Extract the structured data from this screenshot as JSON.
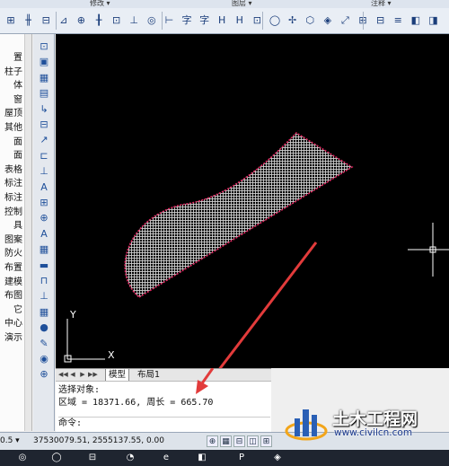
{
  "ribbon": {
    "groups": [
      "修改 ▾",
      "图层 ▾",
      "注释 ▾"
    ],
    "tools": [
      "⊞",
      "╫",
      "⊟",
      "⊿",
      "⊕",
      "╂",
      "⊡",
      "⊥",
      "◎",
      "⊢",
      "字",
      "字",
      "H",
      "H",
      "⊡",
      "◯",
      "✢",
      "⬡",
      "◈",
      "⤢",
      "⊞",
      "⊟",
      "≡",
      "◧",
      "◨"
    ]
  },
  "leftpanel": {
    "items": [
      "置",
      "柱子",
      "体",
      "窗",
      "屋顶",
      "其他",
      "面",
      "面",
      "表格",
      "标注",
      "标注",
      "控制",
      "具",
      "图案",
      "防火",
      "布置",
      "建模",
      "布图",
      "它",
      "中心",
      "演示"
    ]
  },
  "iconbar": {
    "icons": [
      "⊡",
      "▣",
      "▦",
      "▤",
      "↳",
      "⊟",
      "↗",
      "⊏",
      "⊥",
      "A",
      "⊞",
      "⊕",
      "A",
      "▦",
      "▬",
      "⊓",
      "⊥",
      "▦",
      "●",
      "✎",
      "◉",
      "⊕"
    ]
  },
  "canvas": {
    "ucs_y": "Y",
    "ucs_x": "X",
    "colors": {
      "background": "#000000",
      "hatch": "#d9d9d9",
      "outline": "#e0245e",
      "arrow": "#e23b3b"
    }
  },
  "tabs": {
    "nav": [
      "◀◀",
      "◀",
      "▶",
      "▶▶"
    ],
    "items": [
      {
        "label": "模型",
        "active": true
      },
      {
        "label": "布局1",
        "active": false
      }
    ]
  },
  "command": {
    "line1": "选择对象:",
    "line2": "区域 = 18371.66, 周长 = 665.70",
    "prompt": "命令:"
  },
  "status": {
    "scale": "0.5 ▾",
    "coords": "37530079.51, 2555137.55, 0.00",
    "buttons": [
      "⊕",
      "▦",
      "⊟",
      "◫",
      "⊞"
    ]
  },
  "taskbar": {
    "icons": [
      "◎",
      "◯",
      "⊟",
      "◔",
      "e",
      "◧",
      "P",
      "◈"
    ]
  },
  "watermark": {
    "title": "土木工程网",
    "url": "www.civilcn.com"
  }
}
